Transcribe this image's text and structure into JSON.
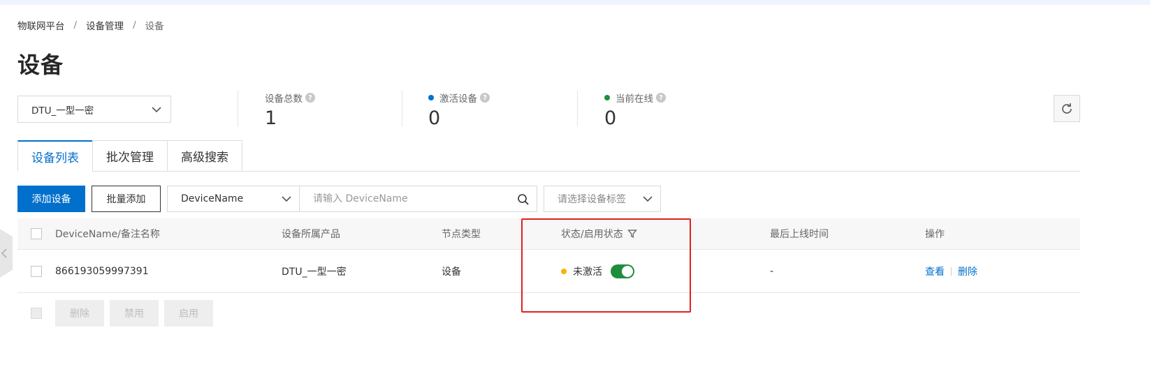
{
  "breadcrumb": {
    "item1": "物联网平台",
    "item2": "设备管理",
    "item3": "设备",
    "separator": "/"
  },
  "page_title": "设备",
  "product_select": {
    "value": "DTU_一型一密"
  },
  "stats": [
    {
      "label": "设备总数",
      "value": "1",
      "dot_color": ""
    },
    {
      "label": "激活设备",
      "value": "0",
      "dot_color": "#0070cc"
    },
    {
      "label": "当前在线",
      "value": "0",
      "dot_color": "#1e8e3e"
    }
  ],
  "tabs": [
    {
      "label": "设备列表",
      "active": true
    },
    {
      "label": "批次管理",
      "active": false
    },
    {
      "label": "高级搜索",
      "active": false
    }
  ],
  "toolbar": {
    "add_label": "添加设备",
    "batch_add_label": "批量添加",
    "field_select_value": "DeviceName",
    "search_placeholder": "请输入 DeviceName",
    "tag_select_placeholder": "请选择设备标签"
  },
  "table": {
    "headers": {
      "name": "DeviceName/备注名称",
      "product": "设备所属产品",
      "node_type": "节点类型",
      "status": "状态/启用状态",
      "last_online": "最后上线时间",
      "actions": "操作"
    },
    "rows": [
      {
        "name": "866193059997391",
        "product": "DTU_一型一密",
        "node_type": "设备",
        "status": "未激活",
        "enabled": true,
        "last_online": "-",
        "view_label": "查看",
        "delete_label": "删除"
      }
    ]
  },
  "footer": {
    "delete_label": "删除",
    "disable_label": "禁用",
    "enable_label": "启用"
  },
  "colors": {
    "primary": "#0070cc",
    "success": "#1e8e3e",
    "warning": "#f5b400",
    "highlight": "#e02020"
  }
}
